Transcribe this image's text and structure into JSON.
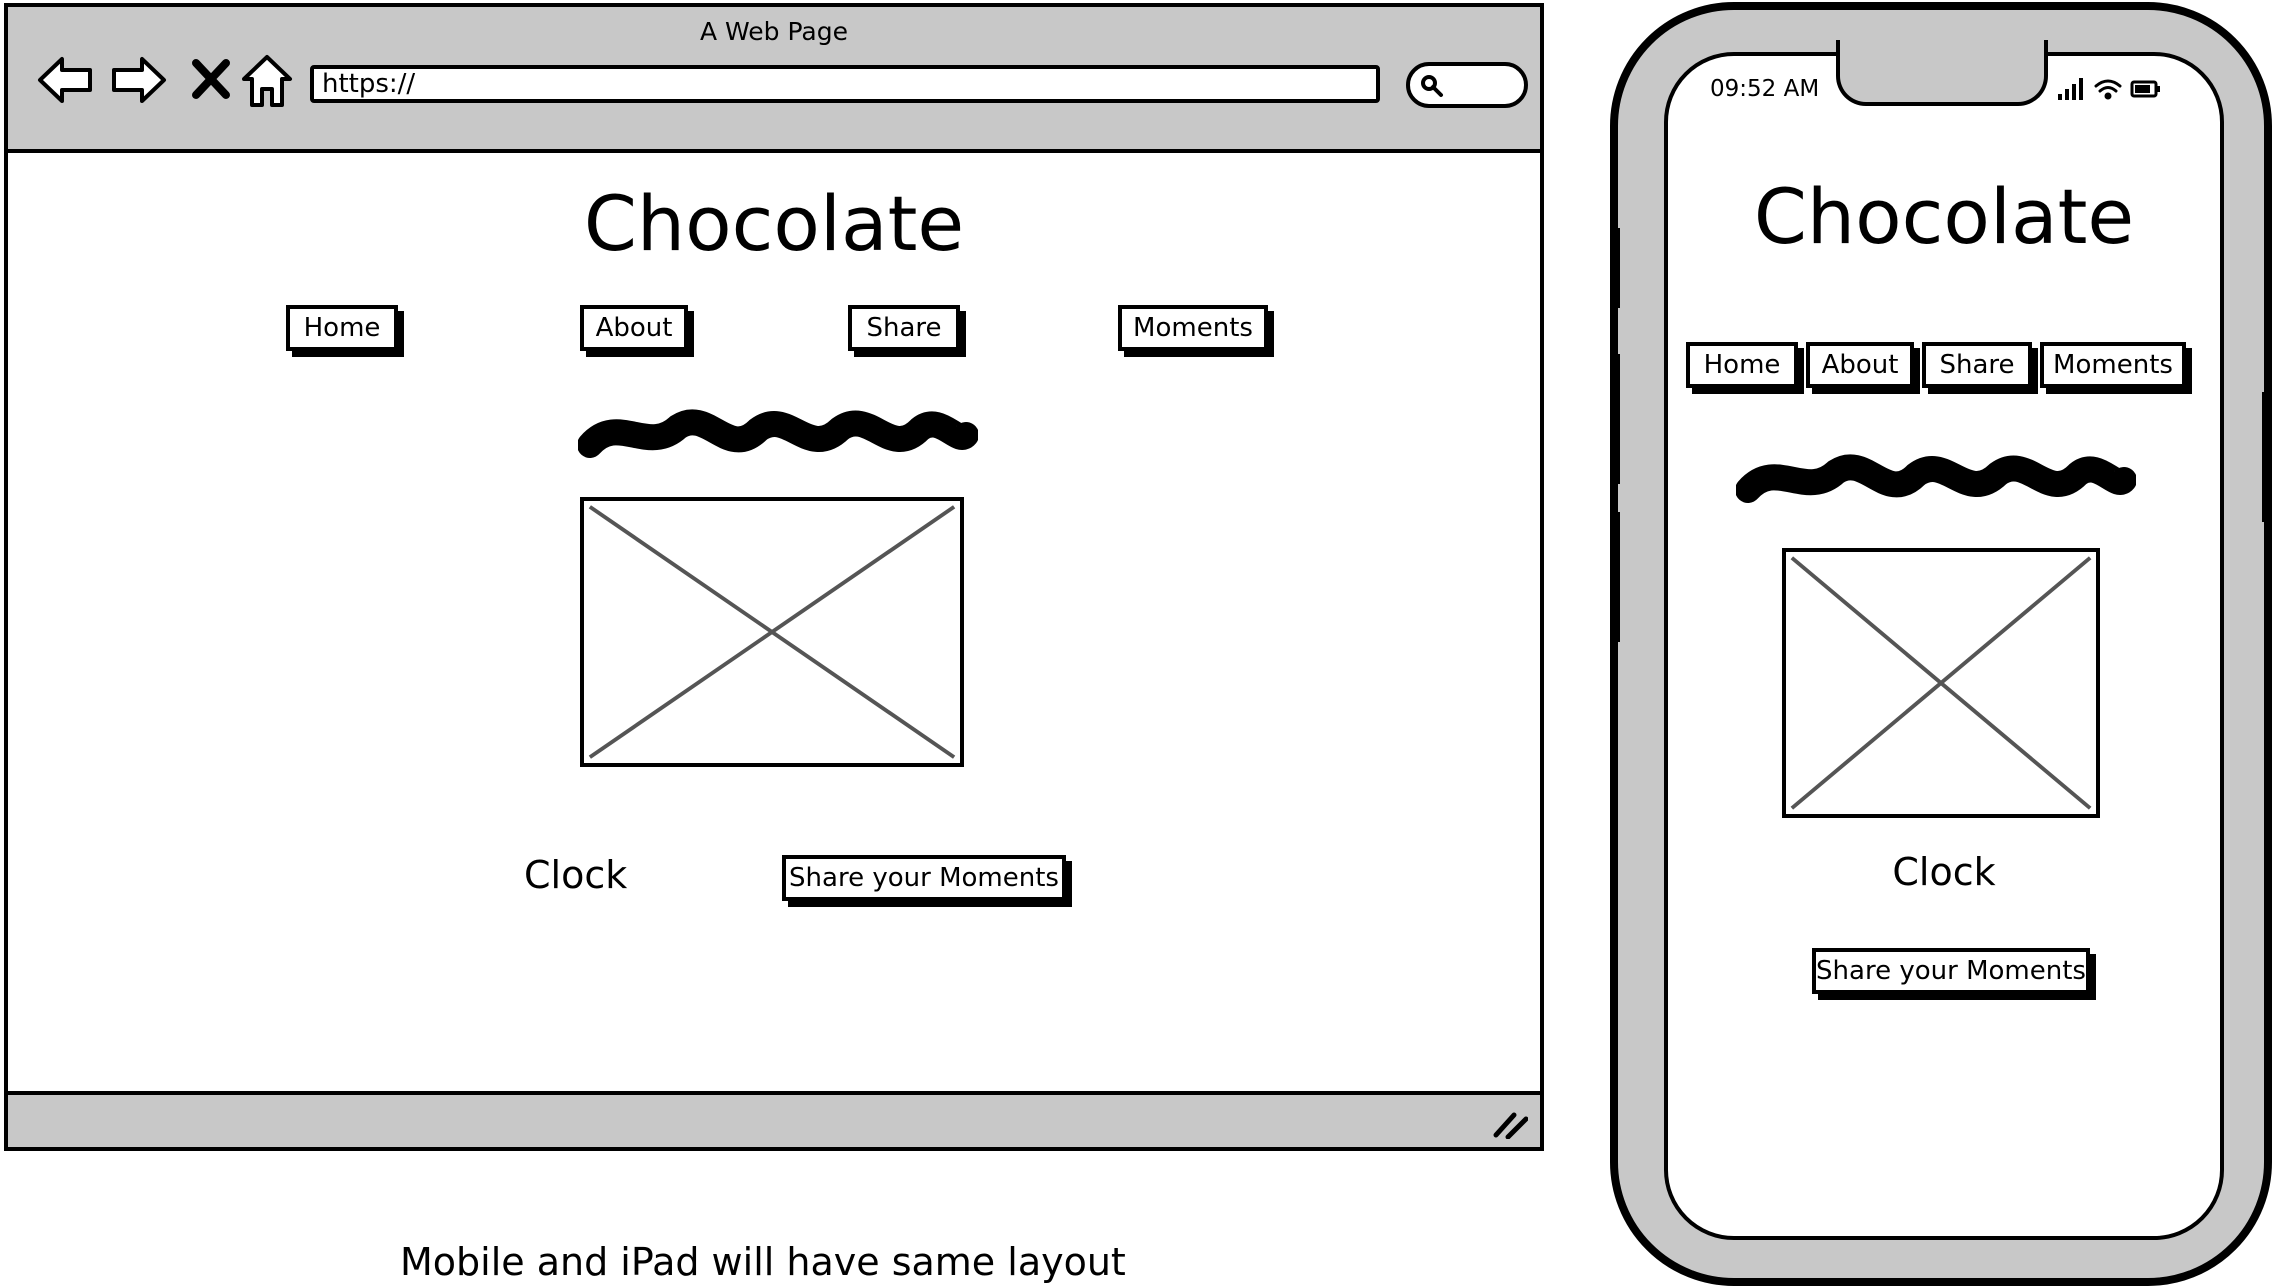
{
  "browser": {
    "window_title": "A Web Page",
    "url": "https://",
    "icons": [
      "back-arrow-icon",
      "forward-arrow-icon",
      "close-x-icon",
      "home-icon",
      "search-icon",
      "resize-grip-icon"
    ]
  },
  "desktop": {
    "title": "Chocolate",
    "nav": [
      {
        "label": "Home"
      },
      {
        "label": "About"
      },
      {
        "label": "Share"
      },
      {
        "label": "Moments"
      }
    ],
    "clock_label": "Clock",
    "cta_label": "Share your Moments"
  },
  "mobile": {
    "status_time": "09:52 AM",
    "status_icons": [
      "signal-icon",
      "wifi-icon",
      "battery-icon"
    ],
    "title": "Chocolate",
    "nav": [
      {
        "label": "Home"
      },
      {
        "label": "About"
      },
      {
        "label": "Share"
      },
      {
        "label": "Moments"
      }
    ],
    "clock_label": "Clock",
    "cta_label": "Share your Moments"
  },
  "caption": "Mobile and iPad will have same layout",
  "colors": {
    "chrome_gray": "#c8c8c8",
    "stroke": "#000000",
    "placeholder_x": "#555555"
  }
}
